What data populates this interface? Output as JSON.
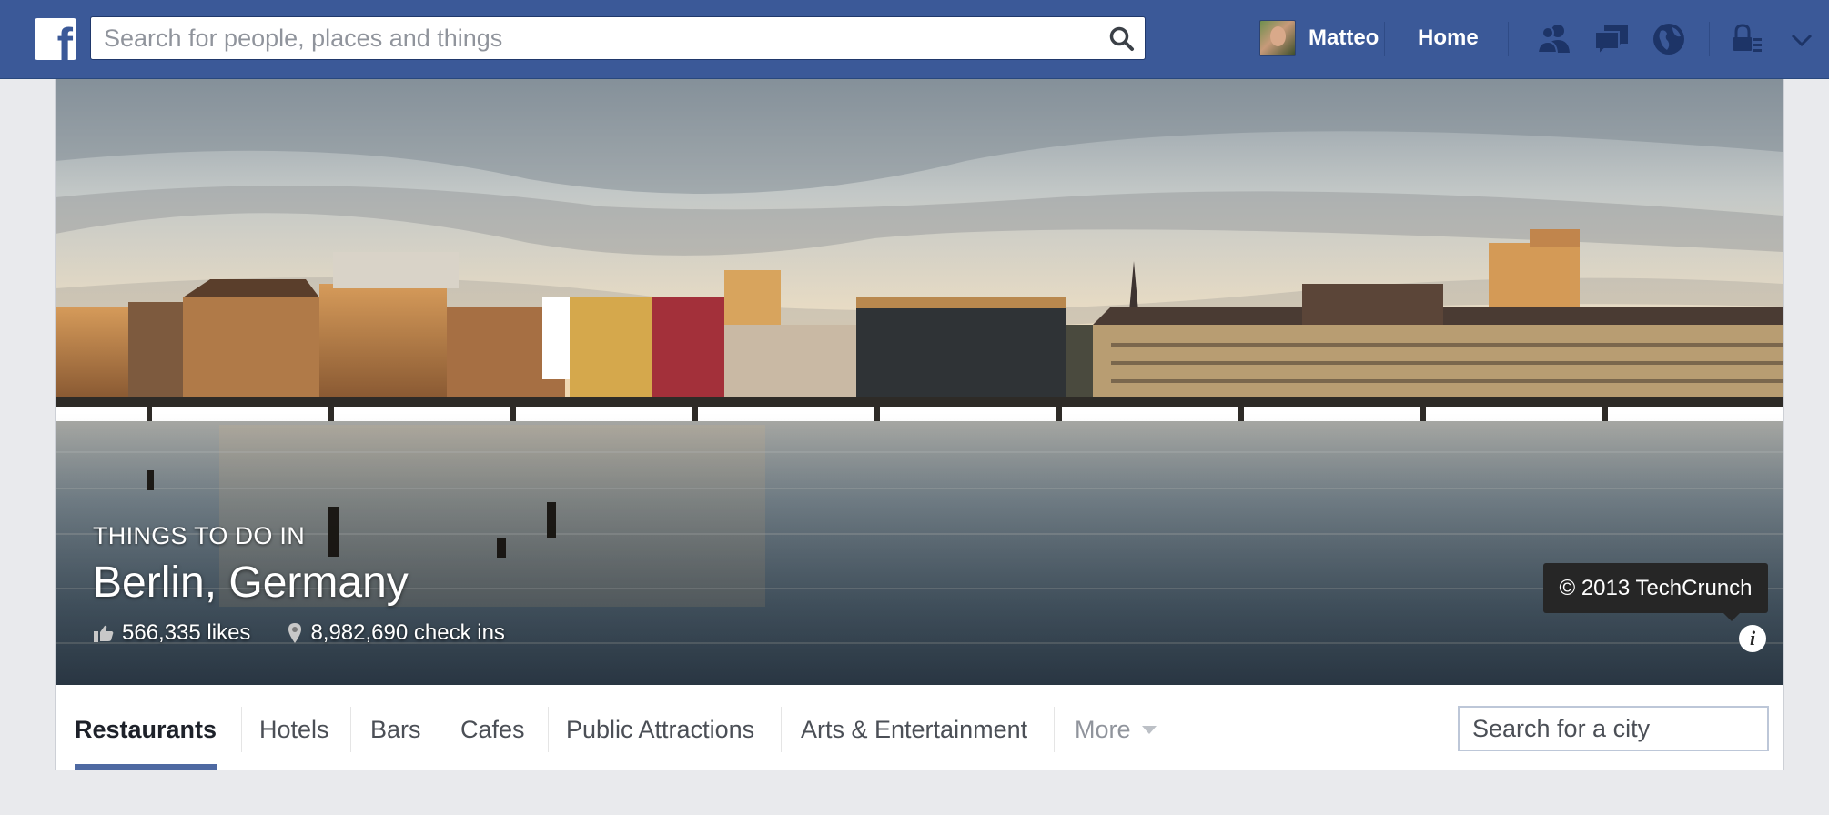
{
  "topbar": {
    "logo": "f",
    "search_placeholder": "Search for people, places and things",
    "user_name": "Matteo",
    "home_label": "Home",
    "icons": [
      "search-icon",
      "friend-requests-icon",
      "messages-icon",
      "notifications-globe-icon",
      "privacy-lock-icon",
      "settings-caret-icon"
    ]
  },
  "cover": {
    "eyebrow": "THINGS TO DO IN",
    "title": "Berlin, Germany",
    "likes": "566,335 likes",
    "checkins": "8,982,690 check ins",
    "copyright": "© 2013 TechCrunch",
    "info_icon": "i"
  },
  "tabs": {
    "items": [
      {
        "label": "Restaurants",
        "active": true
      },
      {
        "label": "Hotels",
        "active": false
      },
      {
        "label": "Bars",
        "active": false
      },
      {
        "label": "Cafes",
        "active": false
      },
      {
        "label": "Public Attractions",
        "active": false
      },
      {
        "label": "Arts & Entertainment",
        "active": false
      }
    ],
    "more_label": "More",
    "city_search_placeholder": "Search for a city"
  },
  "colors": {
    "brand": "#3b5998",
    "active_tab_underline": "#4e69a2",
    "page_bg": "#e9eaed"
  }
}
